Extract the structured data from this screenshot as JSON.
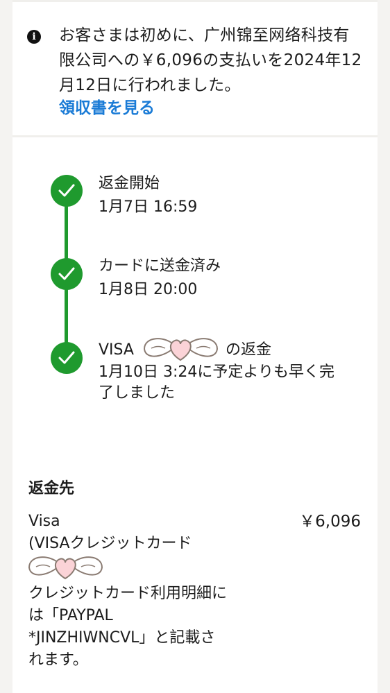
{
  "notice": {
    "icon": "info-icon",
    "text": "お客さまは初めに、广州锦至网络科技有限公司への￥6,096の支払いを2024年12月12日に行われました。",
    "link": "領収書を見る"
  },
  "timeline": [
    {
      "title": "返金開始",
      "detail": "1月7日 16:59"
    },
    {
      "title": "カードに送金済み",
      "detail": "1月8日 20:00"
    },
    {
      "title": "VISA　　　　　　の返金",
      "detail": "1月10日 3:24に予定よりも早く完了しました"
    }
  ],
  "refund": {
    "title": "返金先",
    "method_line1": "Visa",
    "method_line2": "(VISAクレジットカード",
    "amount": "￥6,096",
    "statement": "クレジットカード利用明細には「PAYPAL *JINZHIWNCVL」と記載されます。"
  },
  "colors": {
    "accent_green": "#1f9a2e",
    "link_blue": "#1a7bd6"
  }
}
